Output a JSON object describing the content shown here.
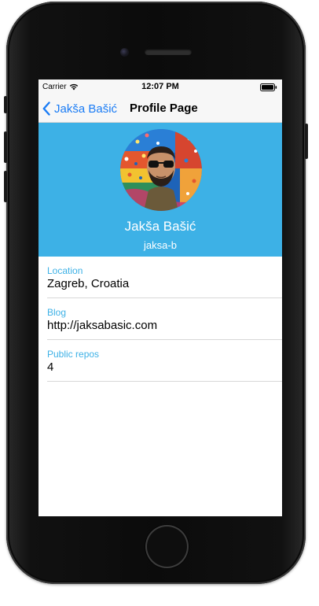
{
  "status_bar": {
    "carrier": "Carrier",
    "time": "12:07 PM",
    "wifi_icon": "wifi-icon",
    "battery_icon": "battery-icon"
  },
  "nav": {
    "back_label": "Jakša Bašić",
    "back_icon": "chevron-left-icon",
    "title": "Profile Page"
  },
  "profile": {
    "name": "Jakša Bašić",
    "login": "jaksa-b",
    "header_color": "#3db1e6"
  },
  "details": [
    {
      "label": "Location",
      "value": "Zagreb, Croatia"
    },
    {
      "label": "Blog",
      "value": "http://jaksabasic.com"
    },
    {
      "label": "Public repos",
      "value": "4"
    }
  ],
  "colors": {
    "accent": "#3db1e6",
    "link": "#1a7cf5"
  }
}
